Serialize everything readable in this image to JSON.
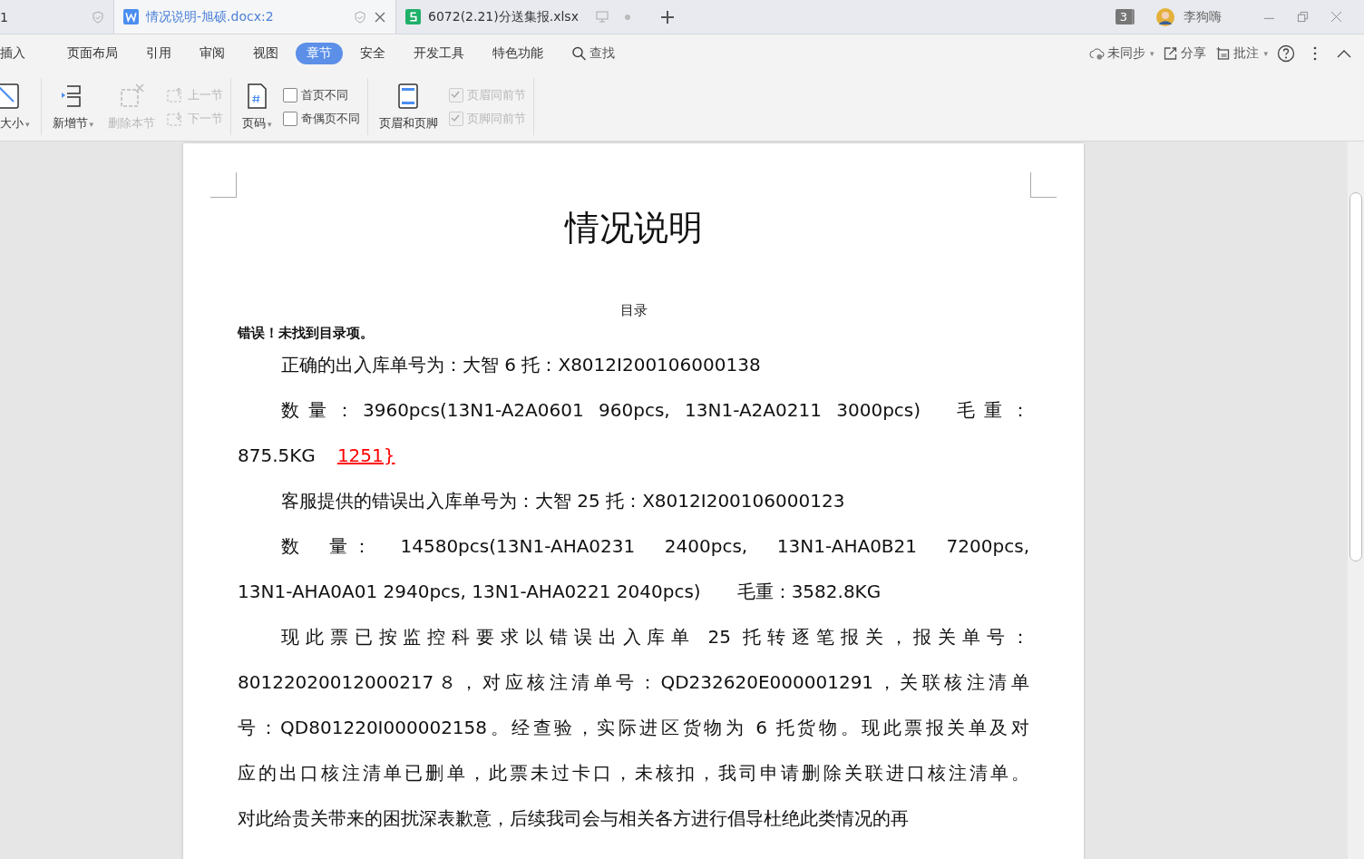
{
  "doc_tabs": [
    {
      "title": "1",
      "kind": "partial",
      "selected": false
    },
    {
      "title": "情况说明-旭硕.docx:2",
      "kind": "writer",
      "selected": true
    },
    {
      "title": "6072(2.21)分送集报.xlsx",
      "kind": "sheet",
      "selected": false
    }
  ],
  "window_count": "3",
  "user": "李狗嗨",
  "ribbon_tabs": [
    {
      "label": "插入",
      "selected": false
    },
    {
      "label": "页面布局",
      "selected": false
    },
    {
      "label": "引用",
      "selected": false
    },
    {
      "label": "审阅",
      "selected": false
    },
    {
      "label": "视图",
      "selected": false
    },
    {
      "label": "章节",
      "selected": true
    },
    {
      "label": "安全",
      "selected": false
    },
    {
      "label": "开发工具",
      "selected": false
    },
    {
      "label": "特色功能",
      "selected": false
    }
  ],
  "search_label": "查找",
  "right_actions": [
    {
      "label": "未同步",
      "caret": "▾"
    },
    {
      "label": "分享"
    },
    {
      "label": "批注",
      "caret": "▾"
    }
  ],
  "toolbar": {
    "size_label": "大小",
    "size_caret": "▾",
    "new_section": "新增节",
    "new_section_caret": "▾",
    "delete_section": "删除本节",
    "prev_section": "上一节",
    "next_section": "下一节",
    "page_number": "页码",
    "page_number_caret": "▾",
    "checks_a": [
      {
        "label": "首页不同",
        "checked": false,
        "disabled": false
      },
      {
        "label": "奇偶页不同",
        "checked": false,
        "disabled": false
      }
    ],
    "header_footer": "页眉和页脚",
    "checks_b": [
      {
        "label": "页眉同前节",
        "checked": true,
        "disabled": true
      },
      {
        "label": "页脚同前节",
        "checked": true,
        "disabled": true
      }
    ]
  },
  "document": {
    "title": "情况说明",
    "toc_heading": "目录",
    "toc_error": "错误！未找到目录项。",
    "paragraphs": [
      {
        "lines": [
          "正确的出入库单号为：大智 6 托：X8012I200106000138"
        ]
      },
      {
        "lines": [
          "数量：3960pcs(13N1-A2A0601 960pcs, 13N1-A2A0211 3000pcs)　毛重：",
          "875.5KG"
        ],
        "inserted": "1251}"
      },
      {
        "lines": [
          "客服提供的错误出入库单号为：大智 25 托：X8012I200106000123"
        ]
      },
      {
        "lines": [
          "数　量：　14580pcs(13N1-AHA0231　2400pcs,　13N1-AHA0B21　7200pcs,",
          "13N1-AHA0A01 2940pcs, 13N1-AHA0221 2040pcs)　　毛重：3582.8KG"
        ]
      },
      {
        "lines": [
          "现此票已按监控科要求以错误出入库单 25 托转逐笔报关，报关单号：",
          "80122020012000217８，对应核注清单号：QD232620E000001291，关联核注清单",
          "号：QD801220I000002158。经查验，实际进区货物为 6 托货物。现此票报关单及对",
          "应的出口核注清单已删单，此票未过卡口，未核扣，我司申请删除关联进口核注清单。",
          "对此给贵关带来的困扰深表歉意，后续我司会与相关各方进行倡导杜绝此类情况的再"
        ]
      }
    ]
  }
}
